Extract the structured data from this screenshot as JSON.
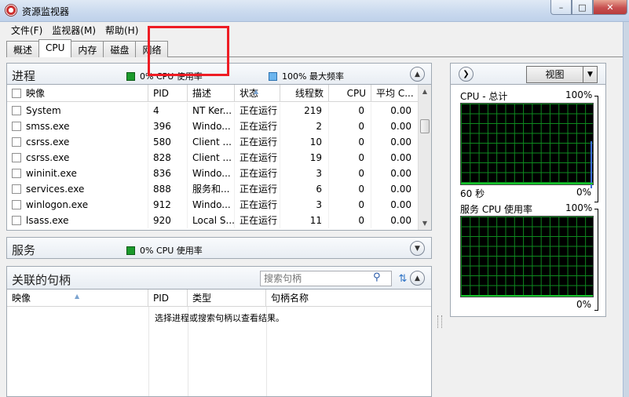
{
  "window": {
    "title": "资源监视器",
    "buttons": {
      "minimize": "–",
      "maximize": "□",
      "close": "✕"
    }
  },
  "menu": [
    "文件(F)",
    "监视器(M)",
    "帮助(H)"
  ],
  "tabs": [
    "概述",
    "CPU",
    "内存",
    "磁盘",
    "网络"
  ],
  "active_tab": "CPU",
  "processes": {
    "title": "进程",
    "legend_cpu": "0% CPU 使用率",
    "legend_freq": "100% 最大频率",
    "columns": [
      "映像",
      "PID",
      "描述",
      "状态",
      "线程数",
      "CPU",
      "平均 C..."
    ],
    "rows": [
      {
        "image": "System",
        "pid": "4",
        "desc": "NT Ker...",
        "status": "正在运行",
        "threads": "219",
        "cpu": "0",
        "avg": "0.00"
      },
      {
        "image": "smss.exe",
        "pid": "396",
        "desc": "Windo...",
        "status": "正在运行",
        "threads": "2",
        "cpu": "0",
        "avg": "0.00"
      },
      {
        "image": "csrss.exe",
        "pid": "580",
        "desc": "Client ...",
        "status": "正在运行",
        "threads": "10",
        "cpu": "0",
        "avg": "0.00"
      },
      {
        "image": "csrss.exe",
        "pid": "828",
        "desc": "Client ...",
        "status": "正在运行",
        "threads": "19",
        "cpu": "0",
        "avg": "0.00"
      },
      {
        "image": "wininit.exe",
        "pid": "836",
        "desc": "Windo...",
        "status": "正在运行",
        "threads": "3",
        "cpu": "0",
        "avg": "0.00"
      },
      {
        "image": "services.exe",
        "pid": "888",
        "desc": "服务和...",
        "status": "正在运行",
        "threads": "6",
        "cpu": "0",
        "avg": "0.00"
      },
      {
        "image": "winlogon.exe",
        "pid": "912",
        "desc": "Windo...",
        "status": "正在运行",
        "threads": "3",
        "cpu": "0",
        "avg": "0.00"
      },
      {
        "image": "lsass.exe",
        "pid": "920",
        "desc": "Local S...",
        "status": "正在运行",
        "threads": "11",
        "cpu": "0",
        "avg": "0.00"
      }
    ]
  },
  "services": {
    "title": "服务",
    "legend_cpu": "0% CPU 使用率"
  },
  "handles": {
    "title": "关联的句柄",
    "search_placeholder": "搜索句柄",
    "columns": [
      "映像",
      "PID",
      "类型",
      "句柄名称"
    ],
    "empty_message": "选择进程或搜索句柄以查看结果。"
  },
  "right_panel": {
    "view_button": "视图",
    "cpu_total_label": "CPU - 总计",
    "cpu_total_max": "100%",
    "cpu_total_time": "60 秒",
    "cpu_total_min": "0%",
    "service_cpu_label": "服务 CPU 使用率",
    "service_cpu_max": "100%",
    "service_cpu_min": "0%"
  },
  "colors": {
    "annotation": "#ee1c24",
    "graph_grid": "#0e8a1f",
    "graph_bg": "#000000",
    "cpu_legend": "#1b9a2b",
    "freq_legend": "#6bb5ee"
  }
}
